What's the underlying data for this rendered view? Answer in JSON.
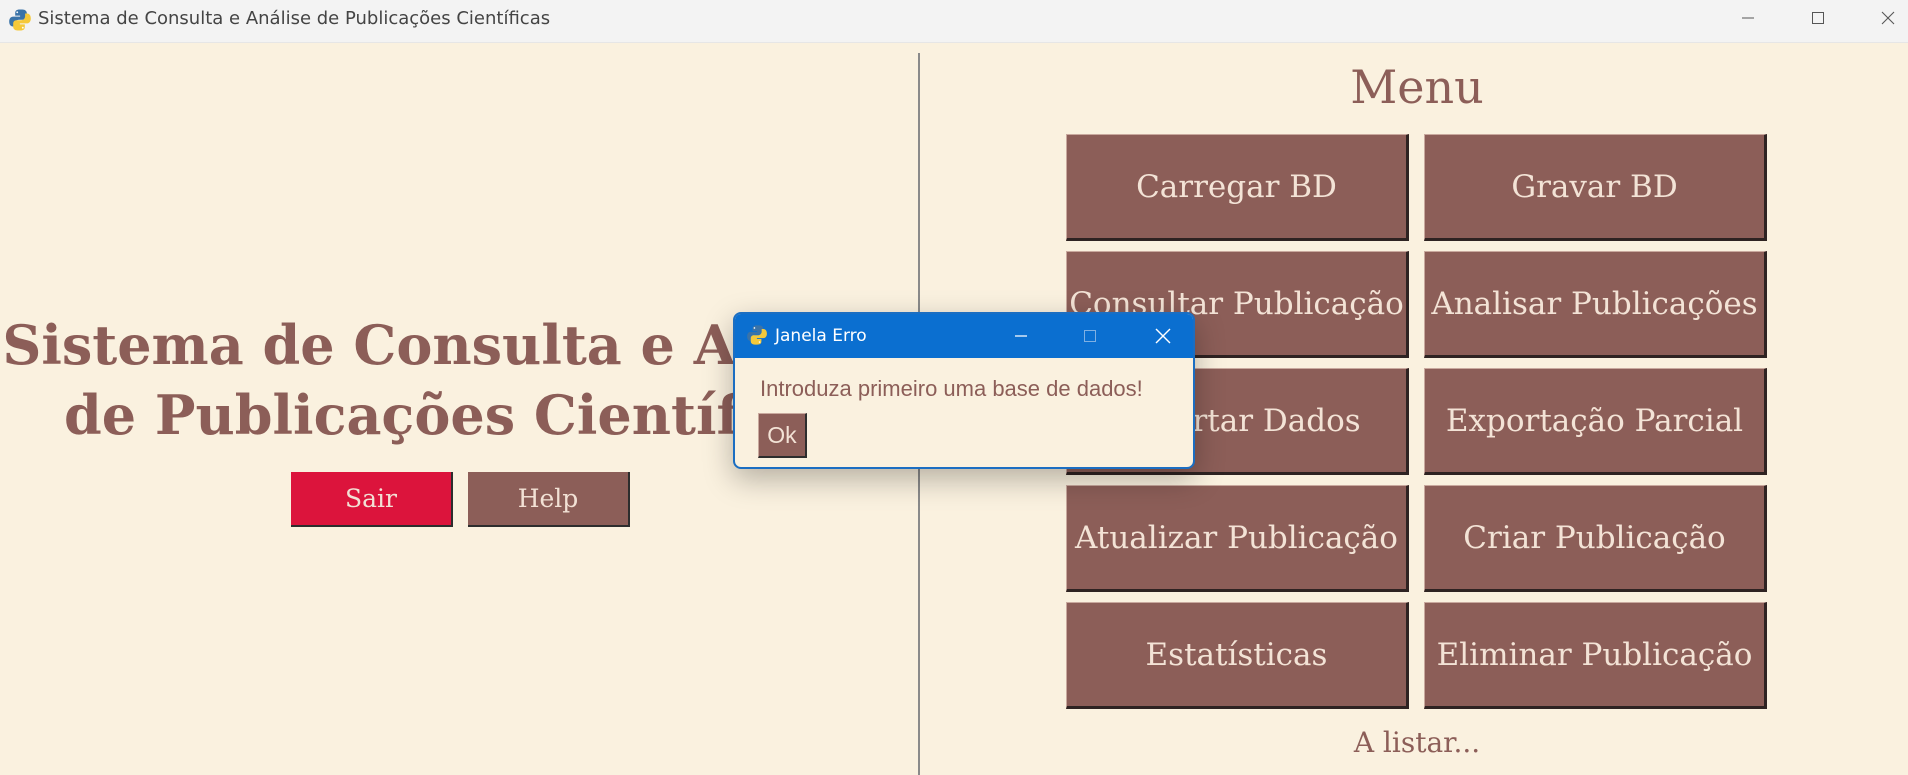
{
  "window": {
    "title": "Sistema de Consulta e Análise de Publicações Científicas",
    "icon": "python-icon"
  },
  "left_panel": {
    "heading": "Sistema de Consulta e Análise\nde Publicações Científicas",
    "sair_label": "Sair",
    "help_label": "Help"
  },
  "menu": {
    "title": "Menu",
    "items": [
      {
        "label": "Carregar BD"
      },
      {
        "label": "Gravar BD"
      },
      {
        "label": "Consultar Publicação"
      },
      {
        "label": "Analisar Publicações"
      },
      {
        "label": "Importar Dados"
      },
      {
        "label": "Exportação Parcial"
      },
      {
        "label": "Atualizar Publicação"
      },
      {
        "label": "Criar Publicação"
      },
      {
        "label": "Estatísticas"
      },
      {
        "label": "Eliminar Publicação"
      }
    ],
    "status": "A listar..."
  },
  "dialog": {
    "title": "Janela Erro",
    "icon": "python-icon",
    "message": "Introduza primeiro uma base de dados!",
    "ok_label": "Ok"
  },
  "colors": {
    "background": "#faf1df",
    "accent": "#8c5e58",
    "danger": "#dc143c",
    "dialog_titlebar": "#0b6fd0"
  }
}
